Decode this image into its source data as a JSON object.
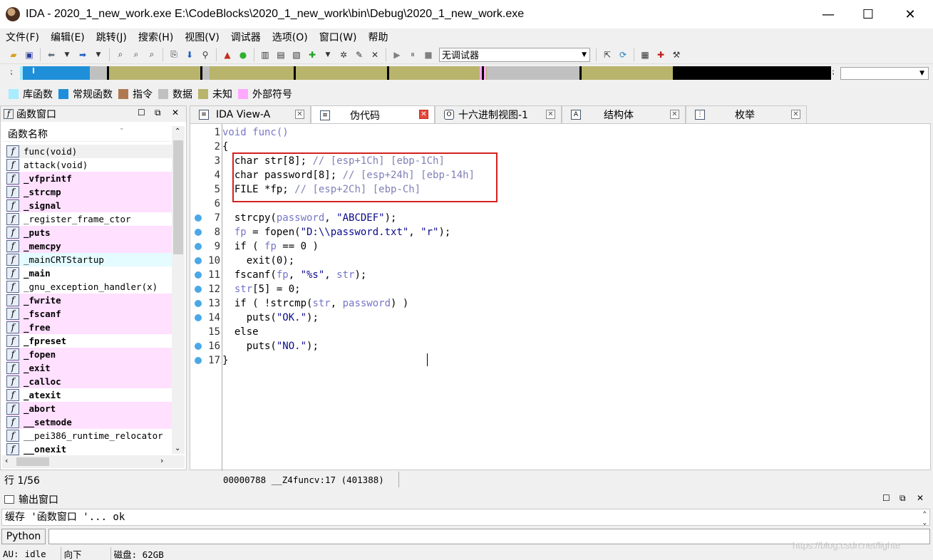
{
  "window": {
    "title": "IDA - 2020_1_new_work.exe E:\\CodeBlocks\\2020_1_new_work\\bin\\Debug\\2020_1_new_work.exe",
    "minimize_glyph": "—",
    "maximize_glyph": "☐",
    "close_glyph": "✕"
  },
  "menu": [
    "文件(F)",
    "编辑(E)",
    "跳转(J)",
    "搜索(H)",
    "视图(V)",
    "调试器",
    "选项(O)",
    "窗口(W)",
    "帮助"
  ],
  "toolbar": {
    "debugger_select": "无调试器"
  },
  "legend": [
    {
      "label": "库函数",
      "color": "#a8ecff"
    },
    {
      "label": "常规函数",
      "color": "#1e8fd8"
    },
    {
      "label": "指令",
      "color": "#b07850"
    },
    {
      "label": "数据",
      "color": "#c0c0c0"
    },
    {
      "label": "未知",
      "color": "#b8b46c"
    },
    {
      "label": "外部符号",
      "color": "#ffa8ff"
    }
  ],
  "func_window": {
    "title": "函数窗口",
    "column_header": "函数名称",
    "functions": [
      {
        "name": "func(void)",
        "bg": "#f0f0f0",
        "bold": false
      },
      {
        "name": "attack(void)",
        "bg": "#ffffff",
        "bold": false
      },
      {
        "name": "_vfprintf",
        "bg": "#ffe0ff",
        "bold": true
      },
      {
        "name": "_strcmp",
        "bg": "#ffe0ff",
        "bold": true
      },
      {
        "name": "_signal",
        "bg": "#ffe0ff",
        "bold": true
      },
      {
        "name": "_register_frame_ctor",
        "bg": "#ffffff",
        "bold": false
      },
      {
        "name": "_puts",
        "bg": "#ffe0ff",
        "bold": true
      },
      {
        "name": "_memcpy",
        "bg": "#ffe0ff",
        "bold": true
      },
      {
        "name": "_mainCRTStartup",
        "bg": "#e4fbff",
        "bold": false
      },
      {
        "name": "_main",
        "bg": "#ffffff",
        "bold": true
      },
      {
        "name": "_gnu_exception_handler(x)",
        "bg": "#ffffff",
        "bold": false
      },
      {
        "name": "_fwrite",
        "bg": "#ffe0ff",
        "bold": true
      },
      {
        "name": "_fscanf",
        "bg": "#ffe0ff",
        "bold": true
      },
      {
        "name": "_free",
        "bg": "#ffe0ff",
        "bold": true
      },
      {
        "name": "_fpreset",
        "bg": "#ffffff",
        "bold": true
      },
      {
        "name": "_fopen",
        "bg": "#ffe0ff",
        "bold": true
      },
      {
        "name": "_exit",
        "bg": "#ffe0ff",
        "bold": true
      },
      {
        "name": "_calloc",
        "bg": "#ffe0ff",
        "bold": true
      },
      {
        "name": "_atexit",
        "bg": "#ffffff",
        "bold": true
      },
      {
        "name": "_abort",
        "bg": "#ffe0ff",
        "bold": true
      },
      {
        "name": "__setmode",
        "bg": "#ffe0ff",
        "bold": true
      },
      {
        "name": "__pei386_runtime_relocator",
        "bg": "#ffffff",
        "bold": false
      },
      {
        "name": "__onexit",
        "bg": "#ffffff",
        "bold": true
      }
    ],
    "row_count": "行 1/56"
  },
  "tabs": [
    {
      "label": "IDA View-A",
      "icon": "≡",
      "active": false
    },
    {
      "label": "伪代码",
      "icon": "≡",
      "active": true
    },
    {
      "label": "十六进制视图-1",
      "icon": "O",
      "active": false
    },
    {
      "label": "结构体",
      "icon": "A",
      "active": false
    },
    {
      "label": "枚举",
      "icon": "⋮",
      "active": false
    }
  ],
  "code_lines": [
    {
      "num": "1",
      "dot": false,
      "html": "<span class=\"cv\">void func()</span>"
    },
    {
      "num": "2",
      "dot": false,
      "html": "{"
    },
    {
      "num": "3",
      "dot": false,
      "html": "  char str[8]; <span class=\"cc\">// [esp+1Ch] [ebp-1Ch]</span>"
    },
    {
      "num": "4",
      "dot": false,
      "html": "  char password[8]; <span class=\"cc\">// [esp+24h] [ebp-14h]</span>"
    },
    {
      "num": "5",
      "dot": false,
      "html": "  FILE *fp; <span class=\"cc\">// [esp+2Ch] [ebp-Ch]</span>"
    },
    {
      "num": "6",
      "dot": false,
      "html": ""
    },
    {
      "num": "7",
      "dot": true,
      "html": "  strcpy(<span class=\"cv\">password</span>, <span class=\"cs\">\"ABCDEF\"</span>);"
    },
    {
      "num": "8",
      "dot": true,
      "html": "  <span class=\"cv\">fp</span> = fopen(<span class=\"cs\">\"D:\\\\password.txt\"</span>, <span class=\"cs\">\"r\"</span>);"
    },
    {
      "num": "9",
      "dot": true,
      "html": "  if ( <span class=\"cv\">fp</span> == 0 )"
    },
    {
      "num": "10",
      "dot": true,
      "html": "    exit(0);"
    },
    {
      "num": "11",
      "dot": true,
      "html": "  fscanf(<span class=\"cv\">fp</span>, <span class=\"cs\">\"%s\"</span>, <span class=\"cv\">str</span>);"
    },
    {
      "num": "12",
      "dot": true,
      "html": "  <span class=\"cv\">str</span>[5] = 0;"
    },
    {
      "num": "13",
      "dot": true,
      "html": "  if ( !strcmp(<span class=\"cv\">str</span>, <span class=\"cv\">password</span>) )"
    },
    {
      "num": "14",
      "dot": true,
      "html": "    puts(<span class=\"cs\">\"OK.\"</span>);"
    },
    {
      "num": "15",
      "dot": false,
      "html": "  else"
    },
    {
      "num": "16",
      "dot": true,
      "html": "    puts(<span class=\"cs\">\"NO.\"</span>);"
    },
    {
      "num": "17",
      "dot": true,
      "html": "}"
    }
  ],
  "code_status": "00000788 __Z4funcv:17 (401388)",
  "output_window": {
    "title": "输出窗口",
    "text": "缓存 '函数窗口     '... ok",
    "python_button": "Python"
  },
  "statusbar": {
    "au": "AU:",
    "state": "idle",
    "direction": "向下",
    "disk": "磁盘: 62GB"
  },
  "watermark": "https://blog.csdn.net/lighte"
}
